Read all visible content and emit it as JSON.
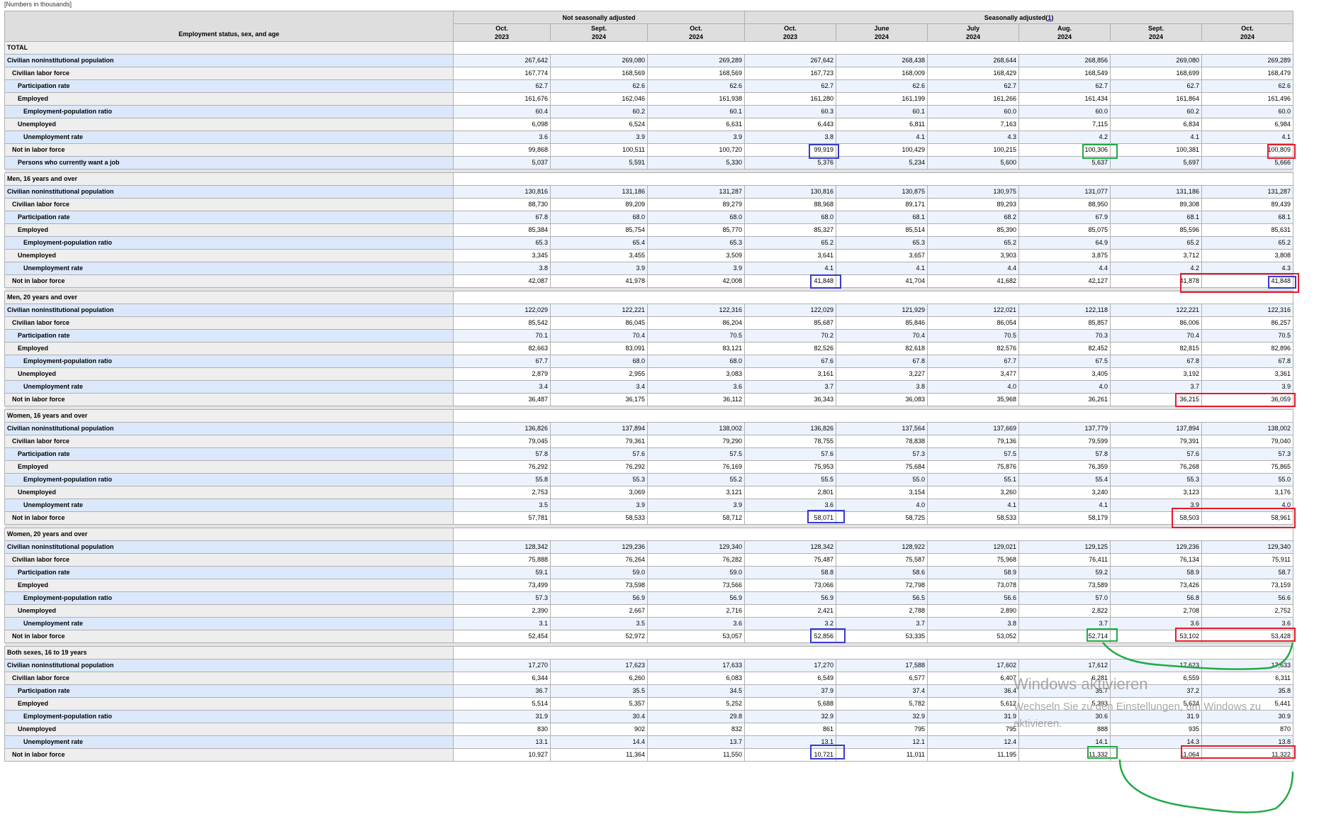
{
  "note": "[Numbers in thousands]",
  "header": {
    "stub": "Employment status, sex, and age",
    "nsa": "Not seasonally adjusted",
    "sa": "Seasonally adjusted",
    "sa_footnote": "1",
    "columns": [
      {
        "month": "Oct.",
        "year": "2023"
      },
      {
        "month": "Sept.",
        "year": "2024"
      },
      {
        "month": "Oct.",
        "year": "2024"
      },
      {
        "month": "Oct.",
        "year": "2023"
      },
      {
        "month": "June",
        "year": "2024"
      },
      {
        "month": "July",
        "year": "2024"
      },
      {
        "month": "Aug.",
        "year": "2024"
      },
      {
        "month": "Sept.",
        "year": "2024"
      },
      {
        "month": "Oct.",
        "year": "2024"
      }
    ]
  },
  "sections": [
    {
      "title": "TOTAL",
      "rows": [
        {
          "label": "Civilian noninstitutional population",
          "level": 0,
          "values": [
            "267,642",
            "269,080",
            "269,289",
            "267,642",
            "268,438",
            "268,644",
            "268,856",
            "269,080",
            "269,289"
          ]
        },
        {
          "label": "Civilian labor force",
          "level": 1,
          "values": [
            "167,774",
            "168,569",
            "168,569",
            "167,723",
            "168,009",
            "168,429",
            "168,549",
            "168,699",
            "168,479"
          ]
        },
        {
          "label": "Participation rate",
          "level": 2,
          "values": [
            "62.7",
            "62.6",
            "62.6",
            "62.7",
            "62.6",
            "62.7",
            "62.7",
            "62.7",
            "62.6"
          ]
        },
        {
          "label": "Employed",
          "level": 2,
          "values": [
            "161,676",
            "162,046",
            "161,938",
            "161,280",
            "161,199",
            "161,266",
            "161,434",
            "161,864",
            "161,496"
          ]
        },
        {
          "label": "Employment-population ratio",
          "level": 3,
          "values": [
            "60.4",
            "60.2",
            "60.1",
            "60.3",
            "60.1",
            "60.0",
            "60.0",
            "60.2",
            "60.0"
          ]
        },
        {
          "label": "Unemployed",
          "level": 2,
          "values": [
            "6,098",
            "6,524",
            "6,631",
            "6,443",
            "6,811",
            "7,163",
            "7,115",
            "6,834",
            "6,984"
          ]
        },
        {
          "label": "Unemployment rate",
          "level": 3,
          "values": [
            "3.6",
            "3.9",
            "3.9",
            "3.8",
            "4.1",
            "4.3",
            "4.2",
            "4.1",
            "4.1"
          ]
        },
        {
          "label": "Not in labor force",
          "level": 1,
          "values": [
            "99,868",
            "100,511",
            "100,720",
            "99,919",
            "100,429",
            "100,215",
            "100,306",
            "100,381",
            "100,809"
          ]
        },
        {
          "label": "Persons who currently want a job",
          "level": 2,
          "values": [
            "5,037",
            "5,591",
            "5,330",
            "5,376",
            "5,234",
            "5,600",
            "5,637",
            "5,697",
            "5,666"
          ]
        }
      ]
    },
    {
      "title": "Men, 16 years and over",
      "rows": [
        {
          "label": "Civilian noninstitutional population",
          "level": 0,
          "values": [
            "130,816",
            "131,186",
            "131,287",
            "130,816",
            "130,875",
            "130,975",
            "131,077",
            "131,186",
            "131,287"
          ]
        },
        {
          "label": "Civilian labor force",
          "level": 1,
          "values": [
            "88,730",
            "89,209",
            "89,279",
            "88,968",
            "89,171",
            "89,293",
            "88,950",
            "89,308",
            "89,439"
          ]
        },
        {
          "label": "Participation rate",
          "level": 2,
          "values": [
            "67.8",
            "68.0",
            "68.0",
            "68.0",
            "68.1",
            "68.2",
            "67.9",
            "68.1",
            "68.1"
          ]
        },
        {
          "label": "Employed",
          "level": 2,
          "values": [
            "85,384",
            "85,754",
            "85,770",
            "85,327",
            "85,514",
            "85,390",
            "85,075",
            "85,596",
            "85,631"
          ]
        },
        {
          "label": "Employment-population ratio",
          "level": 3,
          "values": [
            "65.3",
            "65.4",
            "65.3",
            "65.2",
            "65.3",
            "65.2",
            "64.9",
            "65.2",
            "65.2"
          ]
        },
        {
          "label": "Unemployed",
          "level": 2,
          "values": [
            "3,345",
            "3,455",
            "3,509",
            "3,641",
            "3,657",
            "3,903",
            "3,875",
            "3,712",
            "3,808"
          ]
        },
        {
          "label": "Unemployment rate",
          "level": 3,
          "values": [
            "3.8",
            "3.9",
            "3.9",
            "4.1",
            "4.1",
            "4.4",
            "4.4",
            "4.2",
            "4.3"
          ]
        },
        {
          "label": "Not in labor force",
          "level": 1,
          "values": [
            "42,087",
            "41,978",
            "42,008",
            "41,848",
            "41,704",
            "41,682",
            "42,127",
            "41,878",
            "41,848"
          ]
        }
      ]
    },
    {
      "title": "Men, 20 years and over",
      "rows": [
        {
          "label": "Civilian noninstitutional population",
          "level": 0,
          "values": [
            "122,029",
            "122,221",
            "122,316",
            "122,029",
            "121,929",
            "122,021",
            "122,118",
            "122,221",
            "122,316"
          ]
        },
        {
          "label": "Civilian labor force",
          "level": 1,
          "values": [
            "85,542",
            "86,045",
            "86,204",
            "85,687",
            "85,846",
            "86,054",
            "85,857",
            "86,006",
            "86,257"
          ]
        },
        {
          "label": "Participation rate",
          "level": 2,
          "values": [
            "70.1",
            "70.4",
            "70.5",
            "70.2",
            "70.4",
            "70.5",
            "70.3",
            "70.4",
            "70.5"
          ]
        },
        {
          "label": "Employed",
          "level": 2,
          "values": [
            "82,663",
            "83,091",
            "83,121",
            "82,526",
            "82,618",
            "82,576",
            "82,452",
            "82,815",
            "82,896"
          ]
        },
        {
          "label": "Employment-population ratio",
          "level": 3,
          "values": [
            "67.7",
            "68.0",
            "68.0",
            "67.6",
            "67.8",
            "67.7",
            "67.5",
            "67.8",
            "67.8"
          ]
        },
        {
          "label": "Unemployed",
          "level": 2,
          "values": [
            "2,879",
            "2,955",
            "3,083",
            "3,161",
            "3,227",
            "3,477",
            "3,405",
            "3,192",
            "3,361"
          ]
        },
        {
          "label": "Unemployment rate",
          "level": 3,
          "values": [
            "3.4",
            "3.4",
            "3.6",
            "3.7",
            "3.8",
            "4.0",
            "4.0",
            "3.7",
            "3.9"
          ]
        },
        {
          "label": "Not in labor force",
          "level": 1,
          "values": [
            "36,487",
            "36,175",
            "36,112",
            "36,343",
            "36,083",
            "35,968",
            "36,261",
            "36,215",
            "36,059"
          ]
        }
      ]
    },
    {
      "title": "Women, 16 years and over",
      "rows": [
        {
          "label": "Civilian noninstitutional population",
          "level": 0,
          "values": [
            "136,826",
            "137,894",
            "138,002",
            "136,826",
            "137,564",
            "137,669",
            "137,779",
            "137,894",
            "138,002"
          ]
        },
        {
          "label": "Civilian labor force",
          "level": 1,
          "values": [
            "79,045",
            "79,361",
            "79,290",
            "78,755",
            "78,838",
            "79,136",
            "79,599",
            "79,391",
            "79,040"
          ]
        },
        {
          "label": "Participation rate",
          "level": 2,
          "values": [
            "57.8",
            "57.6",
            "57.5",
            "57.6",
            "57.3",
            "57.5",
            "57.8",
            "57.6",
            "57.3"
          ]
        },
        {
          "label": "Employed",
          "level": 2,
          "values": [
            "76,292",
            "76,292",
            "76,169",
            "75,953",
            "75,684",
            "75,876",
            "76,359",
            "76,268",
            "75,865"
          ]
        },
        {
          "label": "Employment-population ratio",
          "level": 3,
          "values": [
            "55.8",
            "55.3",
            "55.2",
            "55.5",
            "55.0",
            "55.1",
            "55.4",
            "55.3",
            "55.0"
          ]
        },
        {
          "label": "Unemployed",
          "level": 2,
          "values": [
            "2,753",
            "3,069",
            "3,121",
            "2,801",
            "3,154",
            "3,260",
            "3,240",
            "3,123",
            "3,176"
          ]
        },
        {
          "label": "Unemployment rate",
          "level": 3,
          "values": [
            "3.5",
            "3.9",
            "3.9",
            "3.6",
            "4.0",
            "4.1",
            "4.1",
            "3.9",
            "4.0"
          ]
        },
        {
          "label": "Not in labor force",
          "level": 1,
          "values": [
            "57,781",
            "58,533",
            "58,712",
            "58,071",
            "58,725",
            "58,533",
            "58,179",
            "58,503",
            "58,961"
          ]
        }
      ]
    },
    {
      "title": "Women, 20 years and over",
      "rows": [
        {
          "label": "Civilian noninstitutional population",
          "level": 0,
          "values": [
            "128,342",
            "129,236",
            "129,340",
            "128,342",
            "128,922",
            "129,021",
            "129,125",
            "129,236",
            "129,340"
          ]
        },
        {
          "label": "Civilian labor force",
          "level": 1,
          "values": [
            "75,888",
            "76,264",
            "76,282",
            "75,487",
            "75,587",
            "75,968",
            "76,411",
            "76,134",
            "75,911"
          ]
        },
        {
          "label": "Participation rate",
          "level": 2,
          "values": [
            "59.1",
            "59.0",
            "59.0",
            "58.8",
            "58.6",
            "58.9",
            "59.2",
            "58.9",
            "58.7"
          ]
        },
        {
          "label": "Employed",
          "level": 2,
          "values": [
            "73,499",
            "73,598",
            "73,566",
            "73,066",
            "72,798",
            "73,078",
            "73,589",
            "73,426",
            "73,159"
          ]
        },
        {
          "label": "Employment-population ratio",
          "level": 3,
          "values": [
            "57.3",
            "56.9",
            "56.9",
            "56.9",
            "56.5",
            "56.6",
            "57.0",
            "56.8",
            "56.6"
          ]
        },
        {
          "label": "Unemployed",
          "level": 2,
          "values": [
            "2,390",
            "2,667",
            "2,716",
            "2,421",
            "2,788",
            "2,890",
            "2,822",
            "2,708",
            "2,752"
          ]
        },
        {
          "label": "Unemployment rate",
          "level": 3,
          "values": [
            "3.1",
            "3.5",
            "3.6",
            "3.2",
            "3.7",
            "3.8",
            "3.7",
            "3.6",
            "3.6"
          ]
        },
        {
          "label": "Not in labor force",
          "level": 1,
          "values": [
            "52,454",
            "52,972",
            "53,057",
            "52,856",
            "53,335",
            "53,052",
            "52,714",
            "53,102",
            "53,428"
          ]
        }
      ]
    },
    {
      "title": "Both sexes, 16 to 19 years",
      "rows": [
        {
          "label": "Civilian noninstitutional population",
          "level": 0,
          "values": [
            "17,270",
            "17,623",
            "17,633",
            "17,270",
            "17,588",
            "17,602",
            "17,612",
            "17,623",
            "17,633"
          ]
        },
        {
          "label": "Civilian labor force",
          "level": 1,
          "values": [
            "6,344",
            "6,260",
            "6,083",
            "6,549",
            "6,577",
            "6,407",
            "6,281",
            "6,559",
            "6,311"
          ]
        },
        {
          "label": "Participation rate",
          "level": 2,
          "values": [
            "36.7",
            "35.5",
            "34.5",
            "37.9",
            "37.4",
            "36.4",
            "35.7",
            "37.2",
            "35.8"
          ]
        },
        {
          "label": "Employed",
          "level": 2,
          "values": [
            "5,514",
            "5,357",
            "5,252",
            "5,688",
            "5,782",
            "5,612",
            "5,393",
            "5,624",
            "5,441"
          ]
        },
        {
          "label": "Employment-population ratio",
          "level": 3,
          "values": [
            "31.9",
            "30.4",
            "29.8",
            "32.9",
            "32.9",
            "31.9",
            "30.6",
            "31.9",
            "30.9"
          ]
        },
        {
          "label": "Unemployed",
          "level": 2,
          "values": [
            "830",
            "902",
            "832",
            "861",
            "795",
            "795",
            "888",
            "935",
            "870"
          ]
        },
        {
          "label": "Unemployment rate",
          "level": 3,
          "values": [
            "13.1",
            "14.4",
            "13.7",
            "13.1",
            "12.1",
            "12.4",
            "14.1",
            "14.3",
            "13.8"
          ]
        },
        {
          "label": "Not in labor force",
          "level": 1,
          "values": [
            "10,927",
            "11,364",
            "11,550",
            "10,721",
            "11,011",
            "11,195",
            "11,332",
            "11,064",
            "11,322"
          ]
        }
      ]
    }
  ],
  "annotation_colors": {
    "blue": "#3a3acc",
    "green": "#22aa44",
    "red": "#e8192c"
  },
  "watermark": {
    "title": "Windows aktivieren",
    "line1": "Wechseln Sie zu den Einstellungen, um Windows zu",
    "line2": "aktivieren."
  }
}
